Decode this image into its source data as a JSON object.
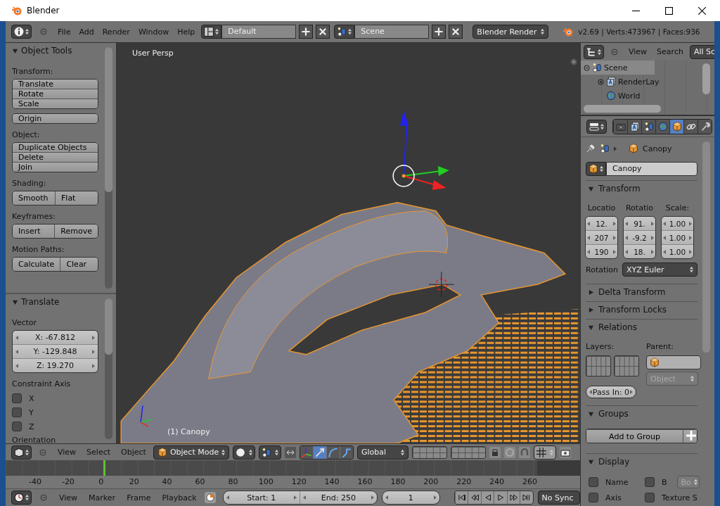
{
  "window": {
    "title": "Blender"
  },
  "info_header": {
    "menus": [
      "File",
      "Add",
      "Render",
      "Window",
      "Help"
    ],
    "screen_layout": "Default",
    "scene": "Scene",
    "render_engine": "Blender Render",
    "stats": "v2.69 | Verts:473967 | Faces:936"
  },
  "tool_shelf": {
    "title": "Object Tools",
    "sections": [
      {
        "label": "Transform:",
        "kind": "column",
        "buttons": [
          "Translate",
          "Rotate",
          "Scale"
        ]
      },
      {
        "kind": "column",
        "buttons": [
          "Origin"
        ]
      },
      {
        "label": "Object:",
        "kind": "column",
        "buttons": [
          "Duplicate Objects",
          "Delete",
          "Join"
        ]
      },
      {
        "label": "Shading:",
        "kind": "row",
        "buttons": [
          "Smooth",
          "Flat"
        ]
      },
      {
        "label": "Keyframes:",
        "kind": "row",
        "buttons": [
          "Insert",
          "Remove"
        ]
      },
      {
        "label": "Motion Paths:",
        "kind": "row",
        "buttons": [
          "Calculate",
          "Clear"
        ]
      }
    ]
  },
  "operator_panel": {
    "title": "Translate",
    "vector_label": "Vector",
    "vector": [
      "X: -67.812",
      "Y: -129.848",
      "Z: 19.270"
    ],
    "constraint_label": "Constraint Axis",
    "axes": [
      {
        "label": "X",
        "checked": false
      },
      {
        "label": "Y",
        "checked": false
      },
      {
        "label": "Z",
        "checked": false
      }
    ],
    "orientation_label": "Orientation"
  },
  "viewport": {
    "view_name": "User Persp",
    "object_label": "(1) Canopy"
  },
  "view3d_header": {
    "menus": [
      "View",
      "Select",
      "Object"
    ],
    "mode": "Object Mode",
    "orientation": "Global"
  },
  "timeline": {
    "ticks": [
      "-40",
      "-20",
      "0",
      "20",
      "40",
      "60",
      "80",
      "100",
      "120",
      "140",
      "160",
      "180",
      "200",
      "220",
      "240",
      "260"
    ]
  },
  "timeline_header": {
    "menus": [
      "View",
      "Marker",
      "Frame",
      "Playback"
    ],
    "start": "Start: 1",
    "end": "End: 250",
    "current": "1",
    "sync": "No Sync"
  },
  "outliner": {
    "menus": [
      "View",
      "Search"
    ],
    "filter": "All Sc",
    "tree": [
      {
        "label": "Scene",
        "kind": "scene",
        "expanded": true,
        "selected": true,
        "children": [
          {
            "label": "RenderLay",
            "kind": "layers",
            "expanded": false,
            "selected": false
          },
          {
            "label": "World",
            "kind": "world",
            "selected": false
          }
        ]
      }
    ]
  },
  "properties": {
    "tabs": [
      {
        "kind": "render",
        "selected": false
      },
      {
        "kind": "layers",
        "selected": false
      },
      {
        "kind": "scene",
        "selected": false
      },
      {
        "kind": "world",
        "selected": false
      },
      {
        "kind": "object",
        "selected": true
      },
      {
        "kind": "constraints",
        "selected": false
      },
      {
        "kind": "modifiers",
        "selected": false
      }
    ],
    "breadcrumb": "Canopy",
    "object_name": "Canopy",
    "panels": [
      {
        "kind": "transform",
        "title": "Transform",
        "expanded": true,
        "columns": [
          {
            "label": "Locatio",
            "values": [
              "12.",
              "207",
              "190"
            ]
          },
          {
            "label": "Rotatio",
            "values": [
              "91.",
              "-9.2",
              "18."
            ]
          },
          {
            "label": "Scale:",
            "values": [
              "1.00",
              "1.00",
              "1.00"
            ]
          }
        ],
        "rotation_label": "Rotation",
        "rotation_mode": "XYZ Euler"
      },
      {
        "title": "Delta Transform",
        "expanded": false
      },
      {
        "title": "Transform Locks",
        "expanded": false
      },
      {
        "kind": "relations",
        "title": "Relations",
        "expanded": true,
        "layers_label": "Layers:",
        "parent_label": "Parent:",
        "parent_type": "Object",
        "pass_index": "Pass In: 0"
      },
      {
        "kind": "groups",
        "title": "Groups",
        "expanded": true,
        "button": "Add to Group"
      },
      {
        "kind": "display",
        "title": "Display",
        "expanded": true,
        "options": [
          {
            "label": "Name",
            "checked": false
          },
          {
            "label": "B",
            "checked": false
          },
          {
            "label": "Axis",
            "checked": false
          },
          {
            "label": "Texture S",
            "checked": false
          }
        ],
        "bounds_type": "Bo"
      }
    ]
  }
}
